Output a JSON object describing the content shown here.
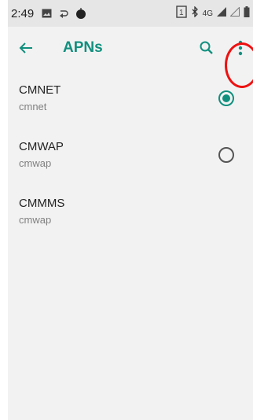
{
  "status_bar": {
    "time": "2:49",
    "network_label": "4G",
    "icons": [
      "image-icon",
      "sync-icon",
      "android-icon",
      "sim-icon",
      "bluetooth-icon",
      "signal-icon",
      "wifi-empty-icon",
      "battery-icon"
    ]
  },
  "app_bar": {
    "title": "APNs",
    "back_icon": "arrow-back-icon",
    "search_icon": "search-icon",
    "more_icon": "more-vert-icon"
  },
  "apn_list": [
    {
      "name": "CMNET",
      "apn": "cmnet",
      "selected": true
    },
    {
      "name": "CMWAP",
      "apn": "cmwap",
      "selected": false
    },
    {
      "name": "CMMMS",
      "apn": "cmwap",
      "selected": null
    }
  ],
  "colors": {
    "accent": "#118f7e",
    "highlight": "#ee1111",
    "background": "#f2f2f2"
  }
}
